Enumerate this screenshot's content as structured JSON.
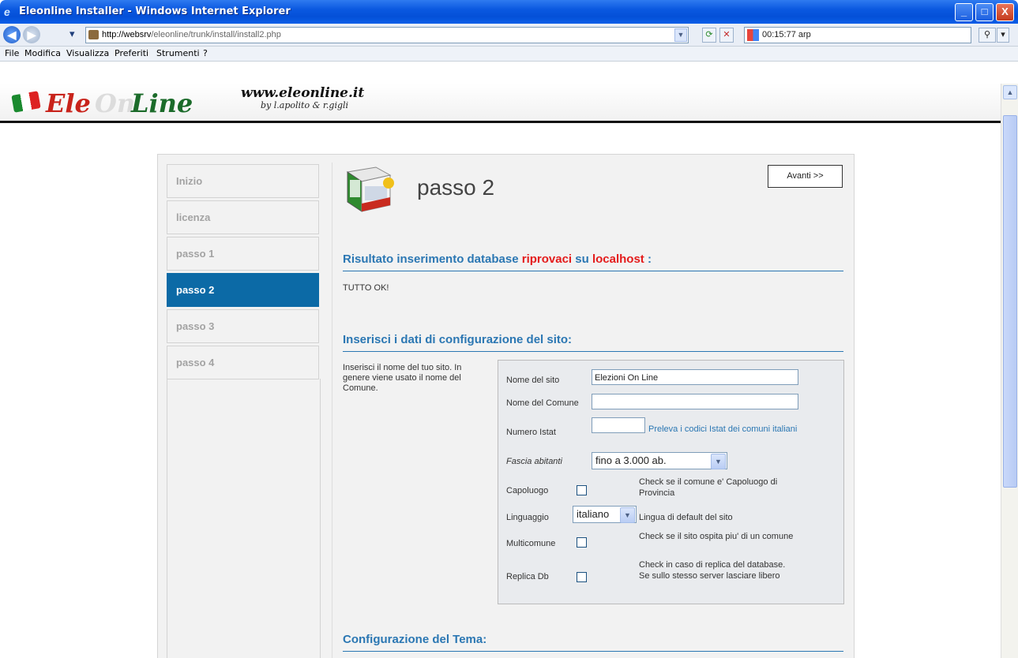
{
  "window": {
    "title": "Eleonline Installer - Windows Internet Explorer",
    "min_label": "_",
    "max_label": "□",
    "close_label": "X"
  },
  "nav": {
    "url_host": "http://websrv",
    "url_path": "/eleonline/trunk/install/install2.php",
    "search_text": "00:15:77 arp",
    "back_glyph": "◀",
    "forward_glyph": "▶",
    "dropdown_glyph": "▾",
    "refresh_glyph": "⟳",
    "stop_glyph": "✕",
    "search_glyph": "⚲"
  },
  "menu": [
    "File",
    "Modifica",
    "Visualizza",
    "Preferiti",
    "Strumenti",
    "?"
  ],
  "header": {
    "logo_ele": "Ele",
    "logo_on": "On",
    "logo_line": "Line",
    "site_url": "www.eleonline.it",
    "authors": "by l.apolito & r.gigli"
  },
  "steps": [
    {
      "label": "Inizio",
      "active": false
    },
    {
      "label": "licenza",
      "active": false
    },
    {
      "label": "passo 1",
      "active": false
    },
    {
      "label": "passo 2",
      "active": true
    },
    {
      "label": "passo 3",
      "active": false
    },
    {
      "label": "passo 4",
      "active": false
    }
  ],
  "main": {
    "title": "passo 2",
    "next_button": "Avanti >>",
    "result_heading_prefix": "Risultato inserimento database ",
    "result_db": "riprovaci",
    "result_mid": " su ",
    "result_host": "localhost",
    "result_suffix": " :",
    "result_text": "TUTTO OK!",
    "config_heading": "Inserisci i dati di configurazione del sito:",
    "config_note": "Inserisci il nome del tuo sito. In genere viene usato il nome del Comune.",
    "theme_heading": "Configurazione del Tema:"
  },
  "form": {
    "site_name_label": "Nome del sito",
    "site_name_value": "Elezioni On Line",
    "comune_label": "Nome del Comune",
    "comune_value": "",
    "istat_label": "Numero Istat",
    "istat_value": "",
    "istat_link": "Preleva i codici Istat dei comuni italiani",
    "fascia_label": "Fascia abitanti",
    "fascia_value": "fino a 3.000 ab.",
    "capoluogo_label": "Capoluogo",
    "capoluogo_checked": false,
    "capoluogo_help": "Check se il comune e' Capoluogo di Provincia",
    "lingua_label": "Linguaggio",
    "lingua_value": "italiano",
    "lingua_help": "Lingua di default del sito",
    "multicomune_label": "Multicomune",
    "multicomune_checked": false,
    "multicomune_help": "Check se il sito ospita piu' di un comune",
    "replica_label": "Replica Db",
    "replica_checked": false,
    "replica_help": "Check in caso di replica del database. Se sullo stesso server lasciare libero"
  },
  "colors": {
    "accent": "#2b77b3",
    "active_step": "#0c6aa6",
    "alert_red": "#e41c1c",
    "logo_red": "#c8231b",
    "logo_green": "#1b6b2a"
  }
}
